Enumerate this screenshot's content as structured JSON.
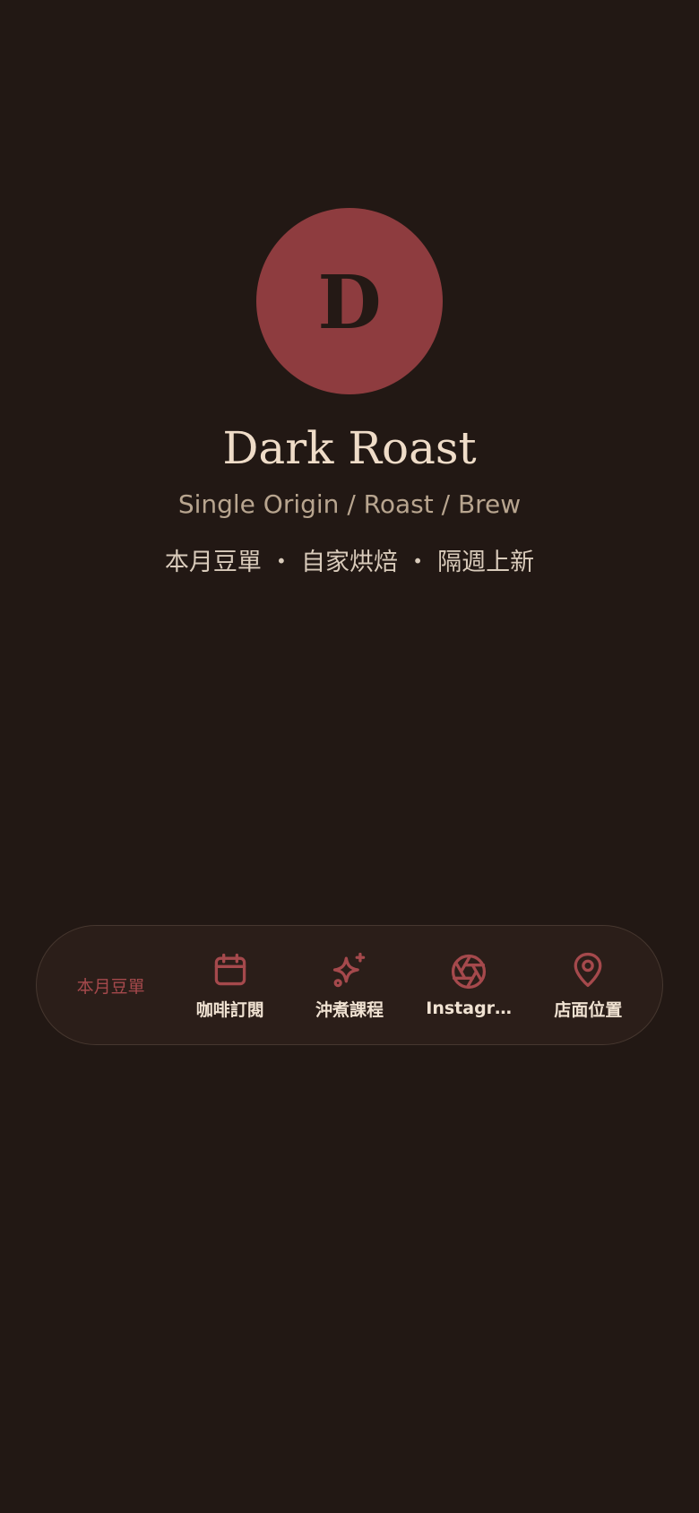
{
  "profile": {
    "avatar_letter": "D",
    "name": "Dark Roast",
    "tagline": "Single Origin / Roast / Brew",
    "features": "本月豆單 ・ 自家烘焙 ・ 隔週上新"
  },
  "nav": {
    "items": [
      {
        "label": "本月豆單",
        "icon": "none",
        "active": true
      },
      {
        "label": "咖啡訂閱",
        "icon": "calendar-icon"
      },
      {
        "label": "沖煮課程",
        "icon": "sparkle-icon"
      },
      {
        "label": "Instagr…",
        "icon": "camera-aperture-icon"
      },
      {
        "label": "店面位置",
        "icon": "map-pin-icon"
      }
    ]
  },
  "colors": {
    "background": "#221814",
    "accent": "#8e3c3f",
    "nav_background": "#2b1e19",
    "title_text": "#efdcc8"
  }
}
